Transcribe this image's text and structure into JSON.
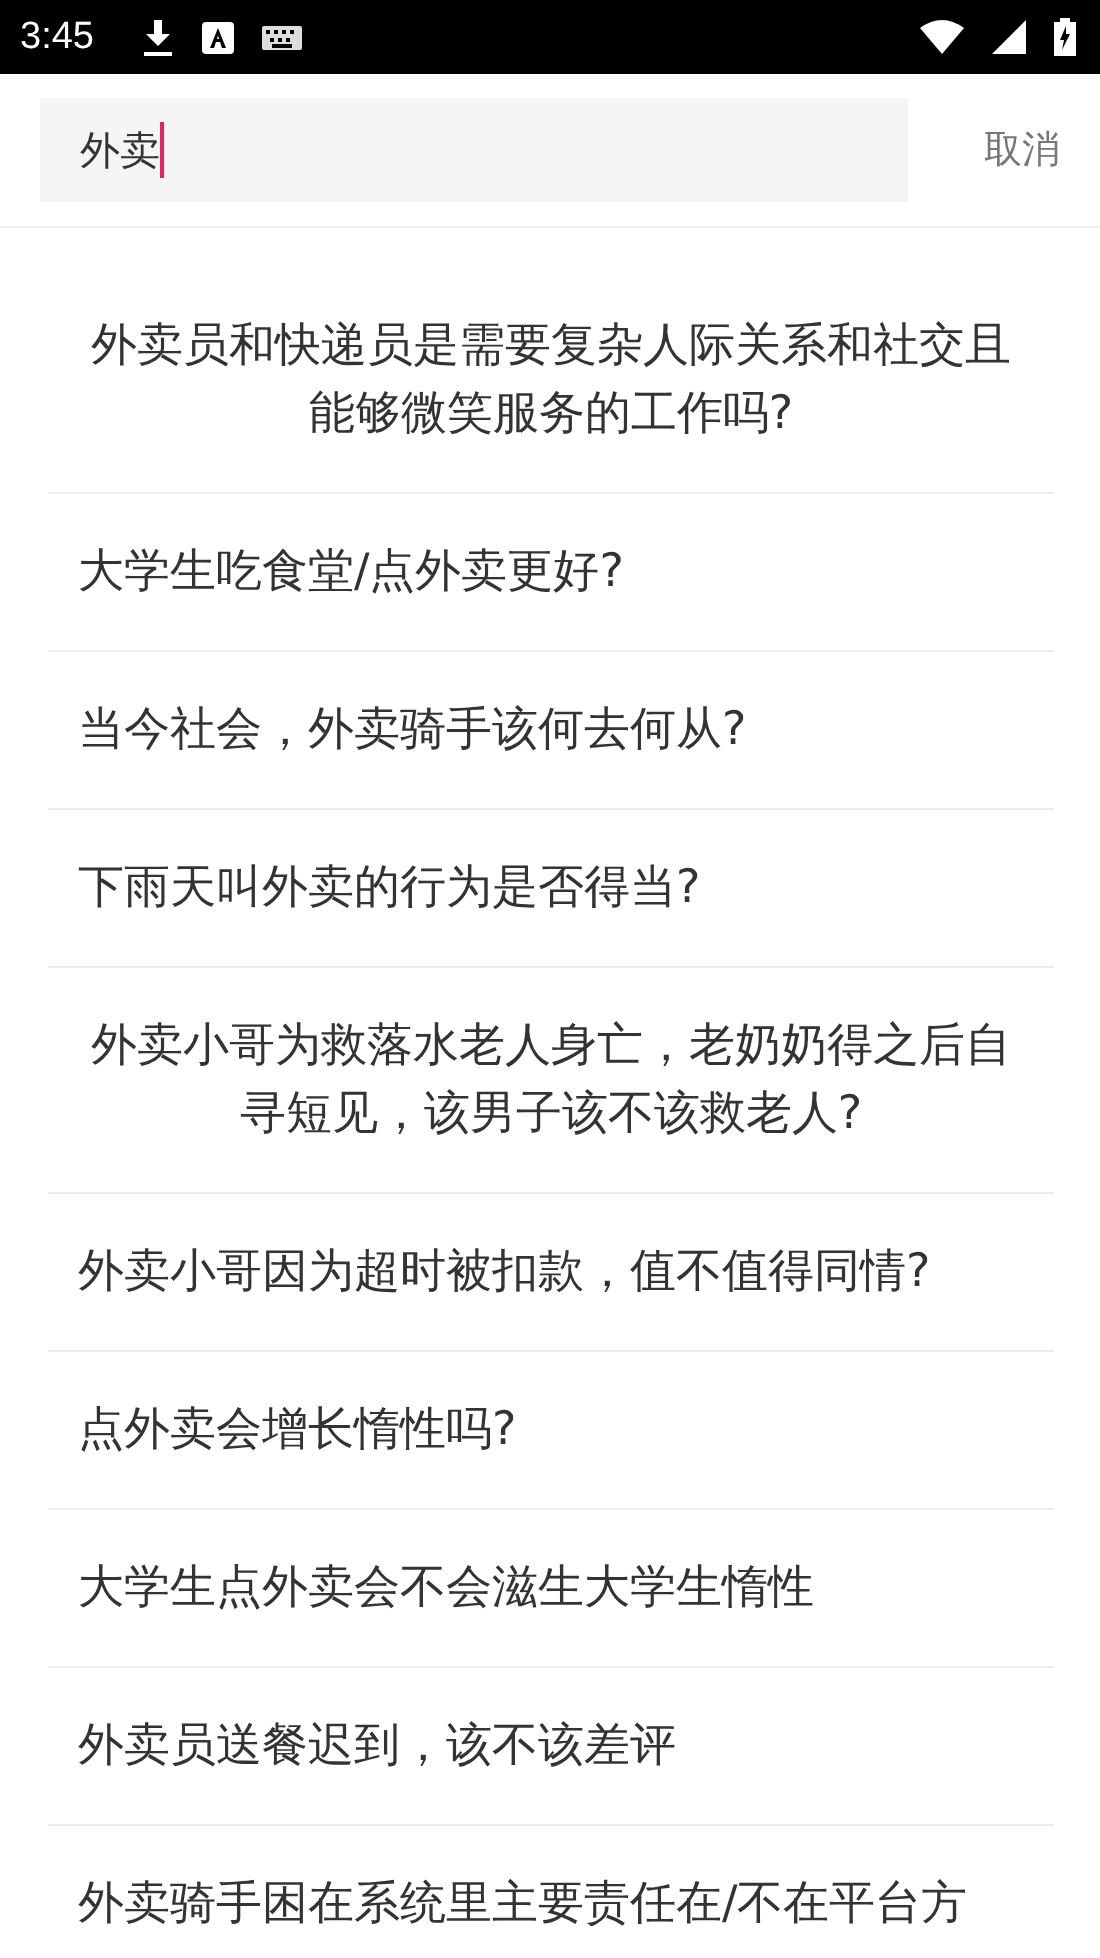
{
  "status_bar": {
    "time": "3:45"
  },
  "search": {
    "value": "外卖",
    "cancel_label": "取消"
  },
  "results": [
    {
      "text": "外卖员和快递员是需要复杂人际关系和社交且能够微笑服务的工作吗?"
    },
    {
      "text": "大学生吃食堂/点外卖更好?"
    },
    {
      "text": "当今社会，外卖骑手该何去何从?"
    },
    {
      "text": "下雨天叫外卖的行为是否得当?"
    },
    {
      "text": "外卖小哥为救落水老人身亡，老奶奶得之后自寻短见，该男子该不该救老人?"
    },
    {
      "text": "外卖小哥因为超时被扣款，值不值得同情?"
    },
    {
      "text": "点外卖会增长惰性吗?"
    },
    {
      "text": "大学生点外卖会不会滋生大学生惰性"
    },
    {
      "text": "外卖员送餐迟到，该不该差评"
    },
    {
      "text": "外卖骑手困在系统里主要责任在/不在平台方"
    }
  ]
}
